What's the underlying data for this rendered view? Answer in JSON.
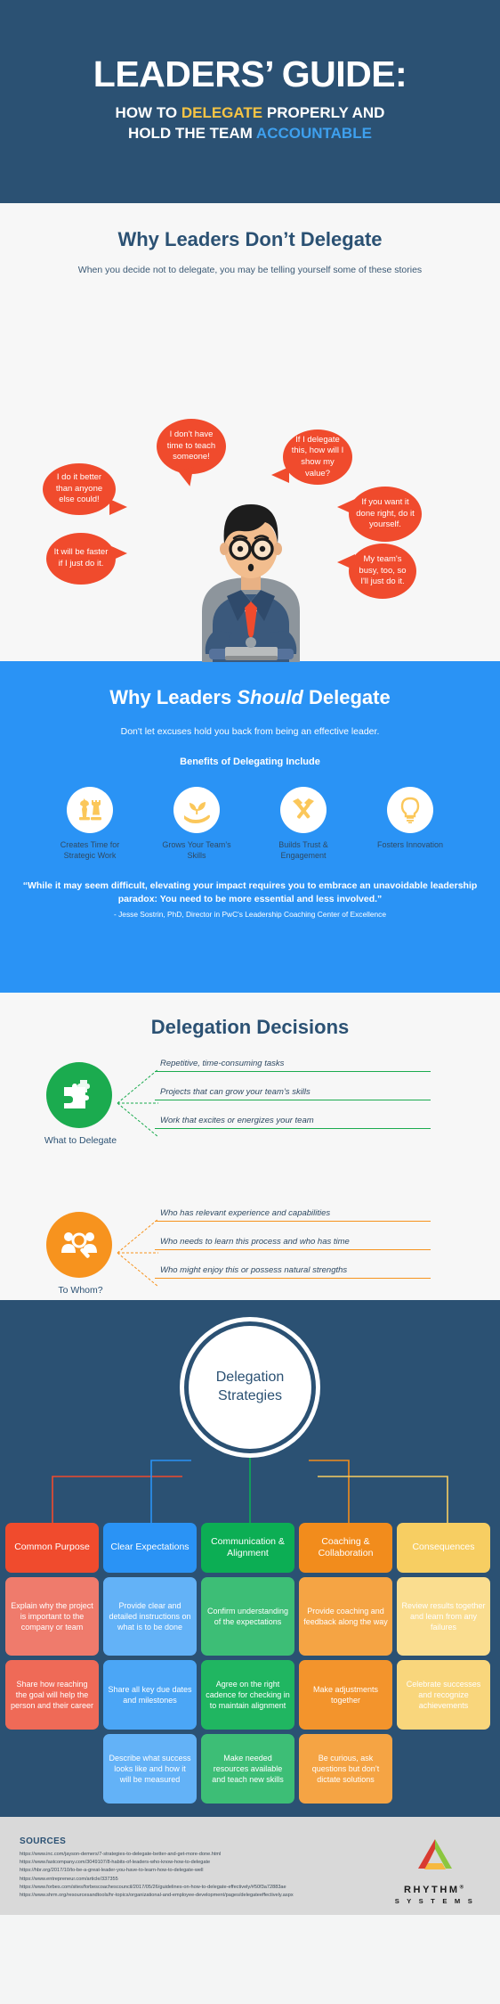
{
  "header": {
    "title": "LEADERS’ GUIDE:",
    "sub_line1_a": "HOW TO ",
    "sub_line1_b": "DELEGATE",
    "sub_line1_c": " PROPERLY AND",
    "sub_line2_a": "HOLD THE TEAM ",
    "sub_line2_b": "ACCOUNTABLE",
    "accent_yellow": "#f6c445",
    "accent_blue": "#3ea0ee",
    "bg": "#2b5173"
  },
  "section_excuses": {
    "title": "Why Leaders Don’t Delegate",
    "subtitle": "When you decide not to delegate, you may be telling yourself some of these stories",
    "bubble_color": "#f04b2d",
    "bubbles": [
      "I don't have time to teach someone!",
      "If I delegate this, how will I show my value?",
      "I do it better than anyone else could!",
      "If you want it done right, do it yourself.",
      "It will be faster if I just do it.",
      "My team's busy, too, so I'll just do it."
    ]
  },
  "section_should": {
    "title_a": "Why Leaders ",
    "title_em": "Should",
    "title_b": " Delegate",
    "lead": "Don't let excuses hold you back from being an effective leader.",
    "benefits_label": "Benefits of Delegating Include",
    "bg": "#2a93f5",
    "icon_color": "#fbc75a",
    "benefits": [
      {
        "icon": "chess-pieces-icon",
        "label": "Creates Time for Strategic Work"
      },
      {
        "icon": "hand-sprout-icon",
        "label": "Grows Your Team’s Skills"
      },
      {
        "icon": "crossed-hammers-icon",
        "label": "Builds Trust & Engagement"
      },
      {
        "icon": "lightbulb-icon",
        "label": "Fosters Innovation"
      }
    ],
    "quote": "“While it may seem difficult, elevating your impact requires you to embrace an unavoidable leadership paradox: You need to be more essential and less involved.”",
    "attribution": "- Jesse Sostrin, PhD, Director in PwC's Leadership Coaching Center of Excellence"
  },
  "section_decisions": {
    "title": "Delegation Decisions",
    "groups": [
      {
        "caption": "What to Delegate",
        "color": "#1bab4f",
        "icon": "puzzle-pieces-icon",
        "lines": [
          "Repetitive, time-consuming tasks",
          "Projects that can grow your team’s skills",
          "Work that excites or energizes your team"
        ]
      },
      {
        "caption": "To Whom?",
        "color": "#f7931e",
        "icon": "people-search-icon",
        "lines": [
          "Who has relevant experience and capabilities",
          "Who needs to learn this process and who has time",
          "Who might enjoy this or possess natural strengths"
        ]
      }
    ]
  },
  "section_strategies": {
    "circle_line1": "Delegation",
    "circle_line2": "Strategies",
    "bg": "#2b5173",
    "columns": [
      {
        "header": "Common Purpose",
        "head_color": "#f04b2d",
        "cards": [
          {
            "text": "Explain why the project is important to the company or team",
            "color": "#ef7b6c"
          },
          {
            "text": "Share how reaching the goal will help the person and their career",
            "color": "#ef6a57"
          }
        ]
      },
      {
        "header": "Clear Expectations",
        "head_color": "#2a93f5",
        "cards": [
          {
            "text": "Provide clear and detailed instructions on what is to be done",
            "color": "#63b2f7"
          },
          {
            "text": "Share all key due dates and milestones",
            "color": "#4ba6f6"
          },
          {
            "text": "Describe what success looks like and how it will be measured",
            "color": "#63b2f7"
          }
        ]
      },
      {
        "header": "Communication & Alignment",
        "head_color": "#0cae54",
        "cards": [
          {
            "text": "Confirm understanding of the expectations",
            "color": "#3dbe76"
          },
          {
            "text": "Agree on the right cadence for checking in to maintain alignment",
            "color": "#20b661"
          },
          {
            "text": "Make needed resources available and teach new skills",
            "color": "#3dbe76"
          }
        ]
      },
      {
        "header": "Coaching & Collaboration",
        "head_color": "#f28c1c",
        "cards": [
          {
            "text": "Provide coaching and feedback along the way",
            "color": "#f5a444"
          },
          {
            "text": "Make adjustments together",
            "color": "#f3942c"
          },
          {
            "text": "Be curious, ask questions but don’t dictate solutions",
            "color": "#f5a444"
          }
        ]
      },
      {
        "header": "Consequences",
        "head_color": "#f7ce62",
        "cards": [
          {
            "text": "Review results together and learn from any failures",
            "color": "#fadd8f"
          },
          {
            "text": "Celebrate successes and recognize achievements",
            "color": "#f9d67c"
          }
        ]
      }
    ]
  },
  "footer": {
    "sources_title": "SOURCES",
    "sources": [
      "https://www.inc.com/jayson-demers/7-strategies-to-delegate-better-and-get-more-done.html",
      "https://www.fastcompany.com/3049107/8-habits-of-leaders-who-know-how-to-delegate",
      "https://hbr.org/2017/10/to-be-a-great-leader-you-have-to-learn-how-to-delegate-well",
      "https://www.entrepreneur.com/article/337355",
      "https://www.forbes.com/sites/forbescoachescouncil/2017/05/26/guidelines-on-how-to-delegate-effectively/#50f3a72883ae",
      "https://www.shrm.org/resourcesandtools/hr-topics/organizational-and-employee-development/pages/delegateeffectively.aspx"
    ],
    "logo_name": "RHYTHM",
    "logo_reg": "®",
    "logo_sub": "S Y S T E M S"
  }
}
